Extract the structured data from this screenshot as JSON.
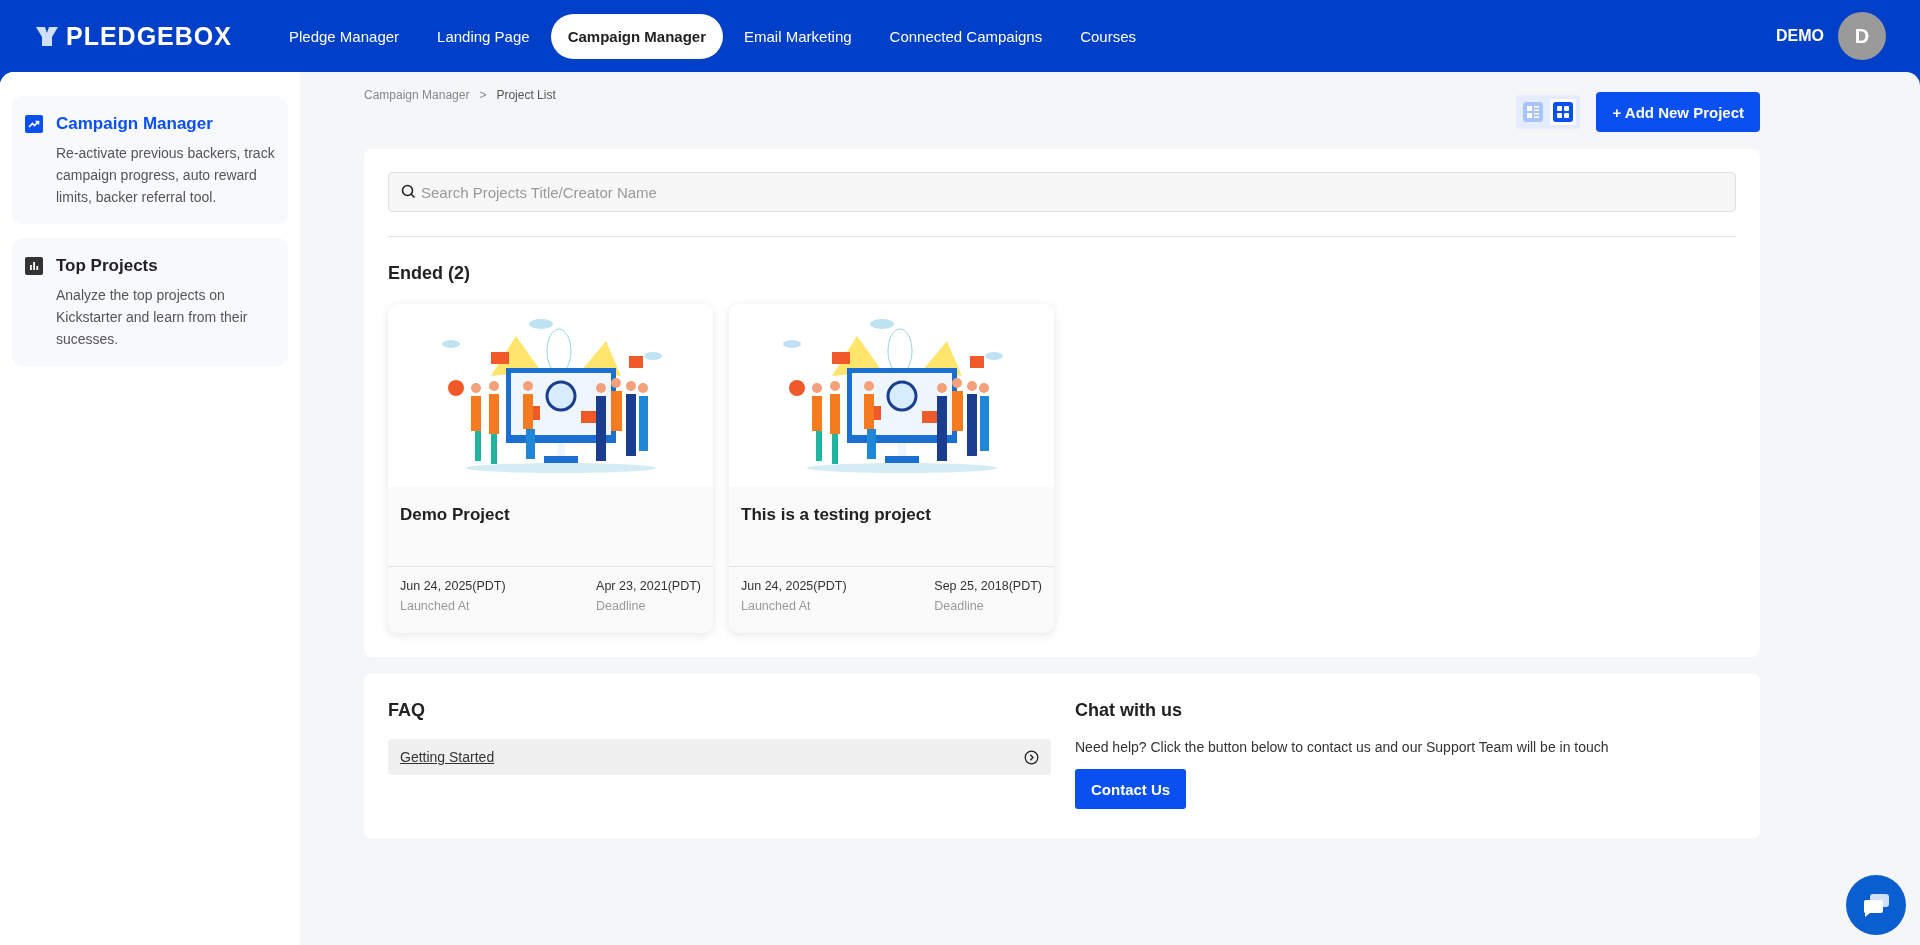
{
  "header": {
    "logo": "PLEDGEBOX",
    "nav": [
      {
        "label": "Pledge Manager",
        "selected": false
      },
      {
        "label": "Landing Page",
        "selected": false
      },
      {
        "label": "Campaign Manager",
        "selected": true
      },
      {
        "label": "Email Marketing",
        "selected": false
      },
      {
        "label": "Connected Campaigns",
        "selected": false
      },
      {
        "label": "Courses",
        "selected": false
      }
    ],
    "user": "DEMO",
    "avatar": "D"
  },
  "sidebar": {
    "items": [
      {
        "kind": "trend",
        "title": "Campaign Manager",
        "description": "Re-activate previous backers, track campaign progress, auto reward limits, backer referral tool.",
        "selected": true
      },
      {
        "kind": "bars",
        "title": "Top Projects",
        "description": "Analyze the top projects on Kickstarter and learn from their sucesses.",
        "selected": false
      }
    ]
  },
  "breadcrumb": [
    "Campaign Manager",
    ">",
    "Project List"
  ],
  "view_toggle": [
    {
      "kind": "list",
      "selected": false
    },
    {
      "kind": "grid",
      "selected": true
    }
  ],
  "add_button": "+ Add New Project",
  "search": {
    "placeholder": "Search Projects Title/Creator Name"
  },
  "section_title": "Ended (2)",
  "projects": [
    {
      "title": "Demo Project",
      "launched": "Jun 24, 2025(PDT)",
      "launched_label": "Launched At",
      "deadline": "Apr 23, 2021(PDT)",
      "deadline_label": "Deadline"
    },
    {
      "title": "This is a testing project",
      "launched": "Jun 24, 2025(PDT)",
      "launched_label": "Launched At",
      "deadline": "Sep 25, 2018(PDT)",
      "deadline_label": "Deadline"
    }
  ],
  "faq": {
    "title": "FAQ",
    "items": [
      "Getting Started"
    ]
  },
  "chat": {
    "title": "Chat with us",
    "text": "Need help? Click the button below to contact us and our Support Team will be in touch",
    "button": "Contact Us"
  }
}
